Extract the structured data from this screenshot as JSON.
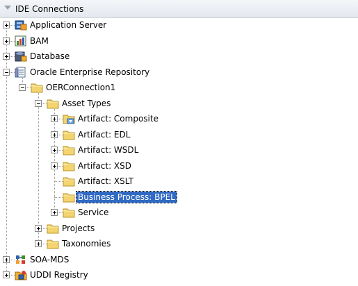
{
  "header": {
    "title": "IDE Connections"
  },
  "tree": [
    {
      "label": "Application Server",
      "icon": "application-server-icon",
      "level": 0,
      "expander": "plus",
      "selected": false
    },
    {
      "label": "BAM",
      "icon": "bam-icon",
      "level": 0,
      "expander": "plus",
      "selected": false
    },
    {
      "label": "Database",
      "icon": "database-icon",
      "level": 0,
      "expander": "plus",
      "selected": false
    },
    {
      "label": "Oracle Enterprise Repository",
      "icon": "repository-icon",
      "level": 0,
      "expander": "minus",
      "selected": false
    },
    {
      "label": "OERConnection1",
      "icon": "folder-icon",
      "level": 1,
      "expander": "minus",
      "selected": false
    },
    {
      "label": "Asset Types",
      "icon": "folder-icon",
      "level": 2,
      "expander": "minus",
      "selected": false
    },
    {
      "label": "Artifact: Composite",
      "icon": "composite-icon",
      "level": 3,
      "expander": "plus",
      "selected": false
    },
    {
      "label": "Artifact: EDL",
      "icon": "folder-icon",
      "level": 3,
      "expander": "plus",
      "selected": false
    },
    {
      "label": "Artifact: WSDL",
      "icon": "folder-icon",
      "level": 3,
      "expander": "plus",
      "selected": false
    },
    {
      "label": "Artifact: XSD",
      "icon": "folder-icon",
      "level": 3,
      "expander": "plus",
      "selected": false
    },
    {
      "label": "Artifact: XSLT",
      "icon": "folder-icon",
      "level": 3,
      "expander": "none",
      "selected": false
    },
    {
      "label": "Business Process: BPEL",
      "icon": "folder-icon",
      "level": 3,
      "expander": "none",
      "selected": true
    },
    {
      "label": "Service",
      "icon": "folder-icon",
      "level": 3,
      "expander": "plus",
      "selected": false
    },
    {
      "label": "Projects",
      "icon": "folder-icon",
      "level": 2,
      "expander": "plus",
      "selected": false
    },
    {
      "label": "Taxonomies",
      "icon": "folder-icon",
      "level": 2,
      "expander": "plus",
      "selected": false
    },
    {
      "label": "SOA-MDS",
      "icon": "soa-mds-icon",
      "level": 0,
      "expander": "plus",
      "selected": false
    },
    {
      "label": "UDDI Registry",
      "icon": "uddi-registry-icon",
      "level": 0,
      "expander": "plus",
      "selected": false
    }
  ],
  "colors": {
    "selection": "#316ac5",
    "folder": "#f3d46e",
    "tree_lines": "#9a9a9a"
  }
}
